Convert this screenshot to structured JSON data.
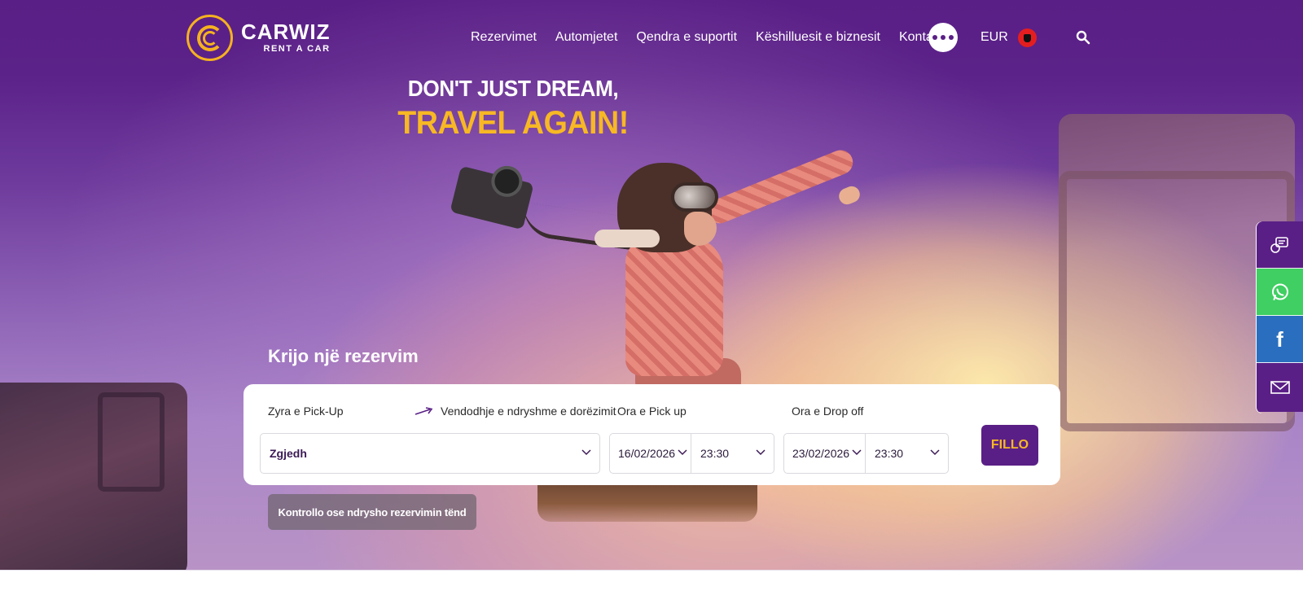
{
  "brand": {
    "name": "CARWIZ",
    "tagline": "RENT A CAR",
    "colors": {
      "primary": "#5a1f86",
      "accent": "#f7b824",
      "whatsapp": "#3fcf62",
      "facebook": "#2a6fbf"
    }
  },
  "nav": {
    "items": [
      {
        "label": "Rezervimet"
      },
      {
        "label": "Automjetet"
      },
      {
        "label": "Qendra e suportit"
      },
      {
        "label": "Këshilluesit e biznesit"
      },
      {
        "label": "Kontaktet"
      }
    ],
    "more_icon": "more-dots-icon",
    "currency": "EUR",
    "language_flag": "albania-flag-icon",
    "search_icon": "search-icon"
  },
  "hero": {
    "line1": "DON'T JUST DREAM,",
    "line2": "TRAVEL AGAIN!"
  },
  "booking": {
    "title": "Krijo një rezervim",
    "pickup_office_label": "Zyra e Pick-Up",
    "different_dropoff_label": "Vendodhje e ndryshme e dorëzimit",
    "pickup_time_label": "Ora e Pick up",
    "dropoff_time_label": "Ora e Drop off",
    "location_value": "Zgjedh",
    "pickup_date": "16/02/2026",
    "pickup_time": "23:30",
    "dropoff_date": "23/02/2026",
    "dropoff_time": "23:30",
    "submit_label": "FILLO",
    "manage_label": "Kontrollo ose ndrysho rezervimin tënd"
  },
  "social_rail": [
    {
      "icon": "support-booking-icon"
    },
    {
      "icon": "whatsapp-icon"
    },
    {
      "icon": "facebook-icon",
      "glyph": "f"
    },
    {
      "icon": "mail-icon"
    }
  ]
}
